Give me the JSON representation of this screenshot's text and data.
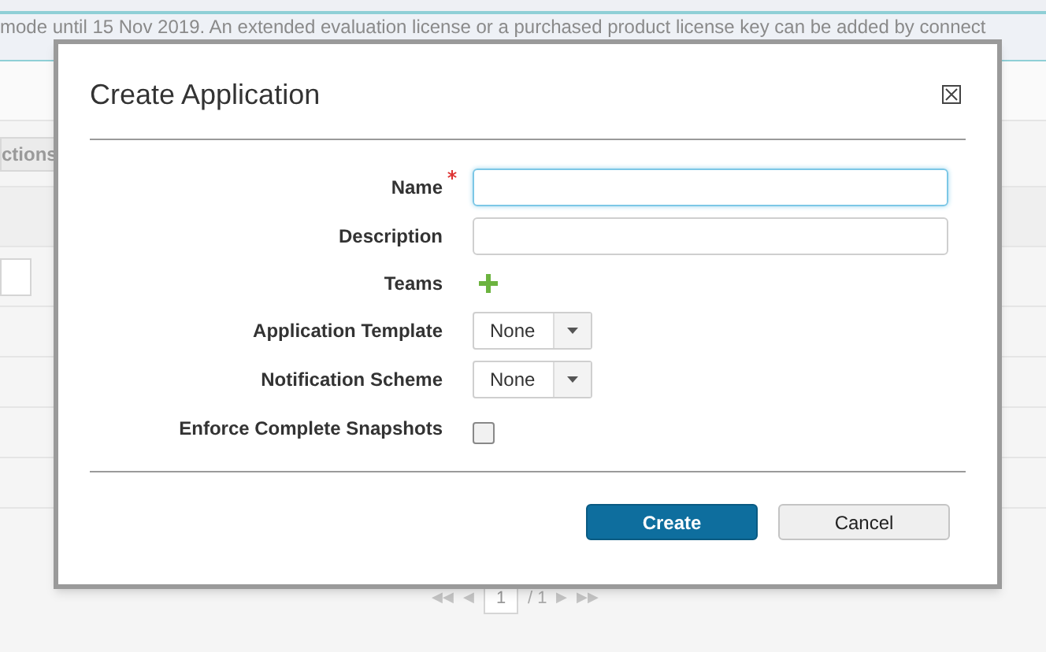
{
  "banner": {
    "text": "mode until 15 Nov 2019. An extended evaluation license or a purchased product license key can be added by connect"
  },
  "background": {
    "actions_button": "ctions",
    "pagination": {
      "first": "◀◀",
      "prev": "◀",
      "page": "1",
      "total": "/ 1",
      "next": "▶",
      "last": "▶▶"
    }
  },
  "dialog": {
    "title": "Create Application",
    "fields": [
      {
        "kind": "text",
        "label": "Name",
        "required": true,
        "focused": true
      },
      {
        "kind": "text",
        "label": "Description",
        "required": false,
        "focused": false
      },
      {
        "kind": "add",
        "label": "Teams",
        "required": false
      },
      {
        "kind": "select",
        "label": "Application Template",
        "required": false,
        "value": "None"
      },
      {
        "kind": "select",
        "label": "Notification Scheme",
        "required": false,
        "value": "None"
      },
      {
        "kind": "checkbox",
        "label": "Enforce Complete Snapshots",
        "required": false,
        "checked": false
      }
    ],
    "buttons": [
      {
        "label": "Create",
        "primary": true
      },
      {
        "label": "Cancel",
        "primary": false
      }
    ]
  }
}
